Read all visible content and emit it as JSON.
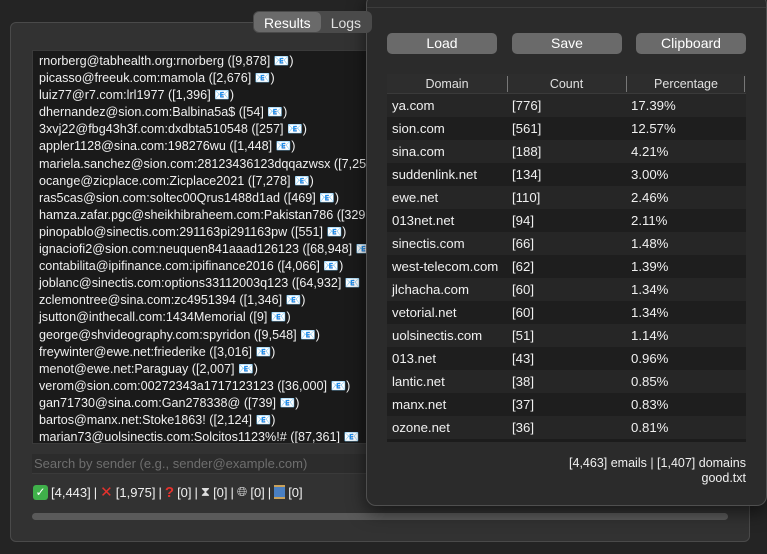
{
  "tabs": [
    "Results",
    "Logs"
  ],
  "results": [
    "rnorberg@tabhealth.org:rnorberg ([9,878] 📧)",
    "picasso@freeuk.com:mamola ([2,676] 📧)",
    "luiz77@r7.com:lrl1977 ([1,396] 📧)",
    "dhernandez@sion.com:Balbina5a$ ([54] 📧)",
    "3xvj22@fbg43h3f.com:dxdbta510548 ([257] 📧)",
    "appler1128@sina.com:198276wu ([1,448] 📧)",
    "mariela.sanchez@sion.com:28123436123dqqazwsx ([7,25",
    "ocange@zicplace.com:Zicplace2021 ([7,278] 📧)",
    "ras5cas@sion.com:soltec00Qrus1488d1ad ([469] 📧)",
    "hamza.zafar.pgc@sheikhibraheem.com:Pakistan786 ([329",
    "pinopablo@sinectis.com:291163pi291163pw ([551] 📧)",
    "ignaciofi2@sion.com:neuquen841aaad126123 ([68,948] 📧",
    "contabilita@ipifinance.com:ipifinance2016 ([4,066] 📧)",
    "joblanc@sinectis.com:options33112003q123 ([64,932] 📧",
    "zclemontree@sina.com:zc4951394 ([1,346] 📧)",
    "jsutton@inthecall.com:1434Memorial ([9] 📧)",
    "george@shvideography.com:spyridon ([9,548] 📧)",
    "freywinter@ewe.net:friederike ([3,016] 📧)",
    "menot@ewe.net:Paraguay ([2,007] 📧)",
    "verom@sion.com:00272343a1717123123 ([36,000] 📧)",
    "gan71730@sina.com:Gan278338@ ([739] 📧)",
    "bartos@manx.net:Stoke1863! ([2,124] 📧)",
    "marian73@uolsinectis.com:Solcitos1123%!# ([87,361] 📧"
  ],
  "search": {
    "placeholder": "Search by sender (e.g., sender@example.com)"
  },
  "status": {
    "valid": "[4,443]",
    "invalid": "[1,975]",
    "unknown": "[0]",
    "pending": "[0]",
    "web": "[0]",
    "spool": "[0]",
    "sep": "|"
  },
  "panel": {
    "buttons": {
      "load": "Load",
      "save": "Save",
      "clipboard": "Clipboard"
    },
    "table": {
      "headers": [
        "Domain",
        "Count",
        "Percentage"
      ],
      "rows": [
        [
          "ya.com",
          "[776]",
          "17.39%"
        ],
        [
          "sion.com",
          "[561]",
          "12.57%"
        ],
        [
          "sina.com",
          "[188]",
          "4.21%"
        ],
        [
          "suddenlink.net",
          "[134]",
          "3.00%"
        ],
        [
          "ewe.net",
          "[110]",
          "2.46%"
        ],
        [
          "013net.net",
          "[94]",
          "2.11%"
        ],
        [
          "sinectis.com",
          "[66]",
          "1.48%"
        ],
        [
          "west-telecom.com",
          "[62]",
          "1.39%"
        ],
        [
          "jlchacha.com",
          "[60]",
          "1.34%"
        ],
        [
          "vetorial.net",
          "[60]",
          "1.34%"
        ],
        [
          "uolsinectis.com",
          "[51]",
          "1.14%"
        ],
        [
          "013.net",
          "[43]",
          "0.96%"
        ],
        [
          "lantic.net",
          "[38]",
          "0.85%"
        ],
        [
          "manx.net",
          "[37]",
          "0.83%"
        ],
        [
          "ozone.net",
          "[36]",
          "0.81%"
        ]
      ]
    },
    "summary": "[4,463] emails | [1,407] domains",
    "filename": "good.txt"
  }
}
